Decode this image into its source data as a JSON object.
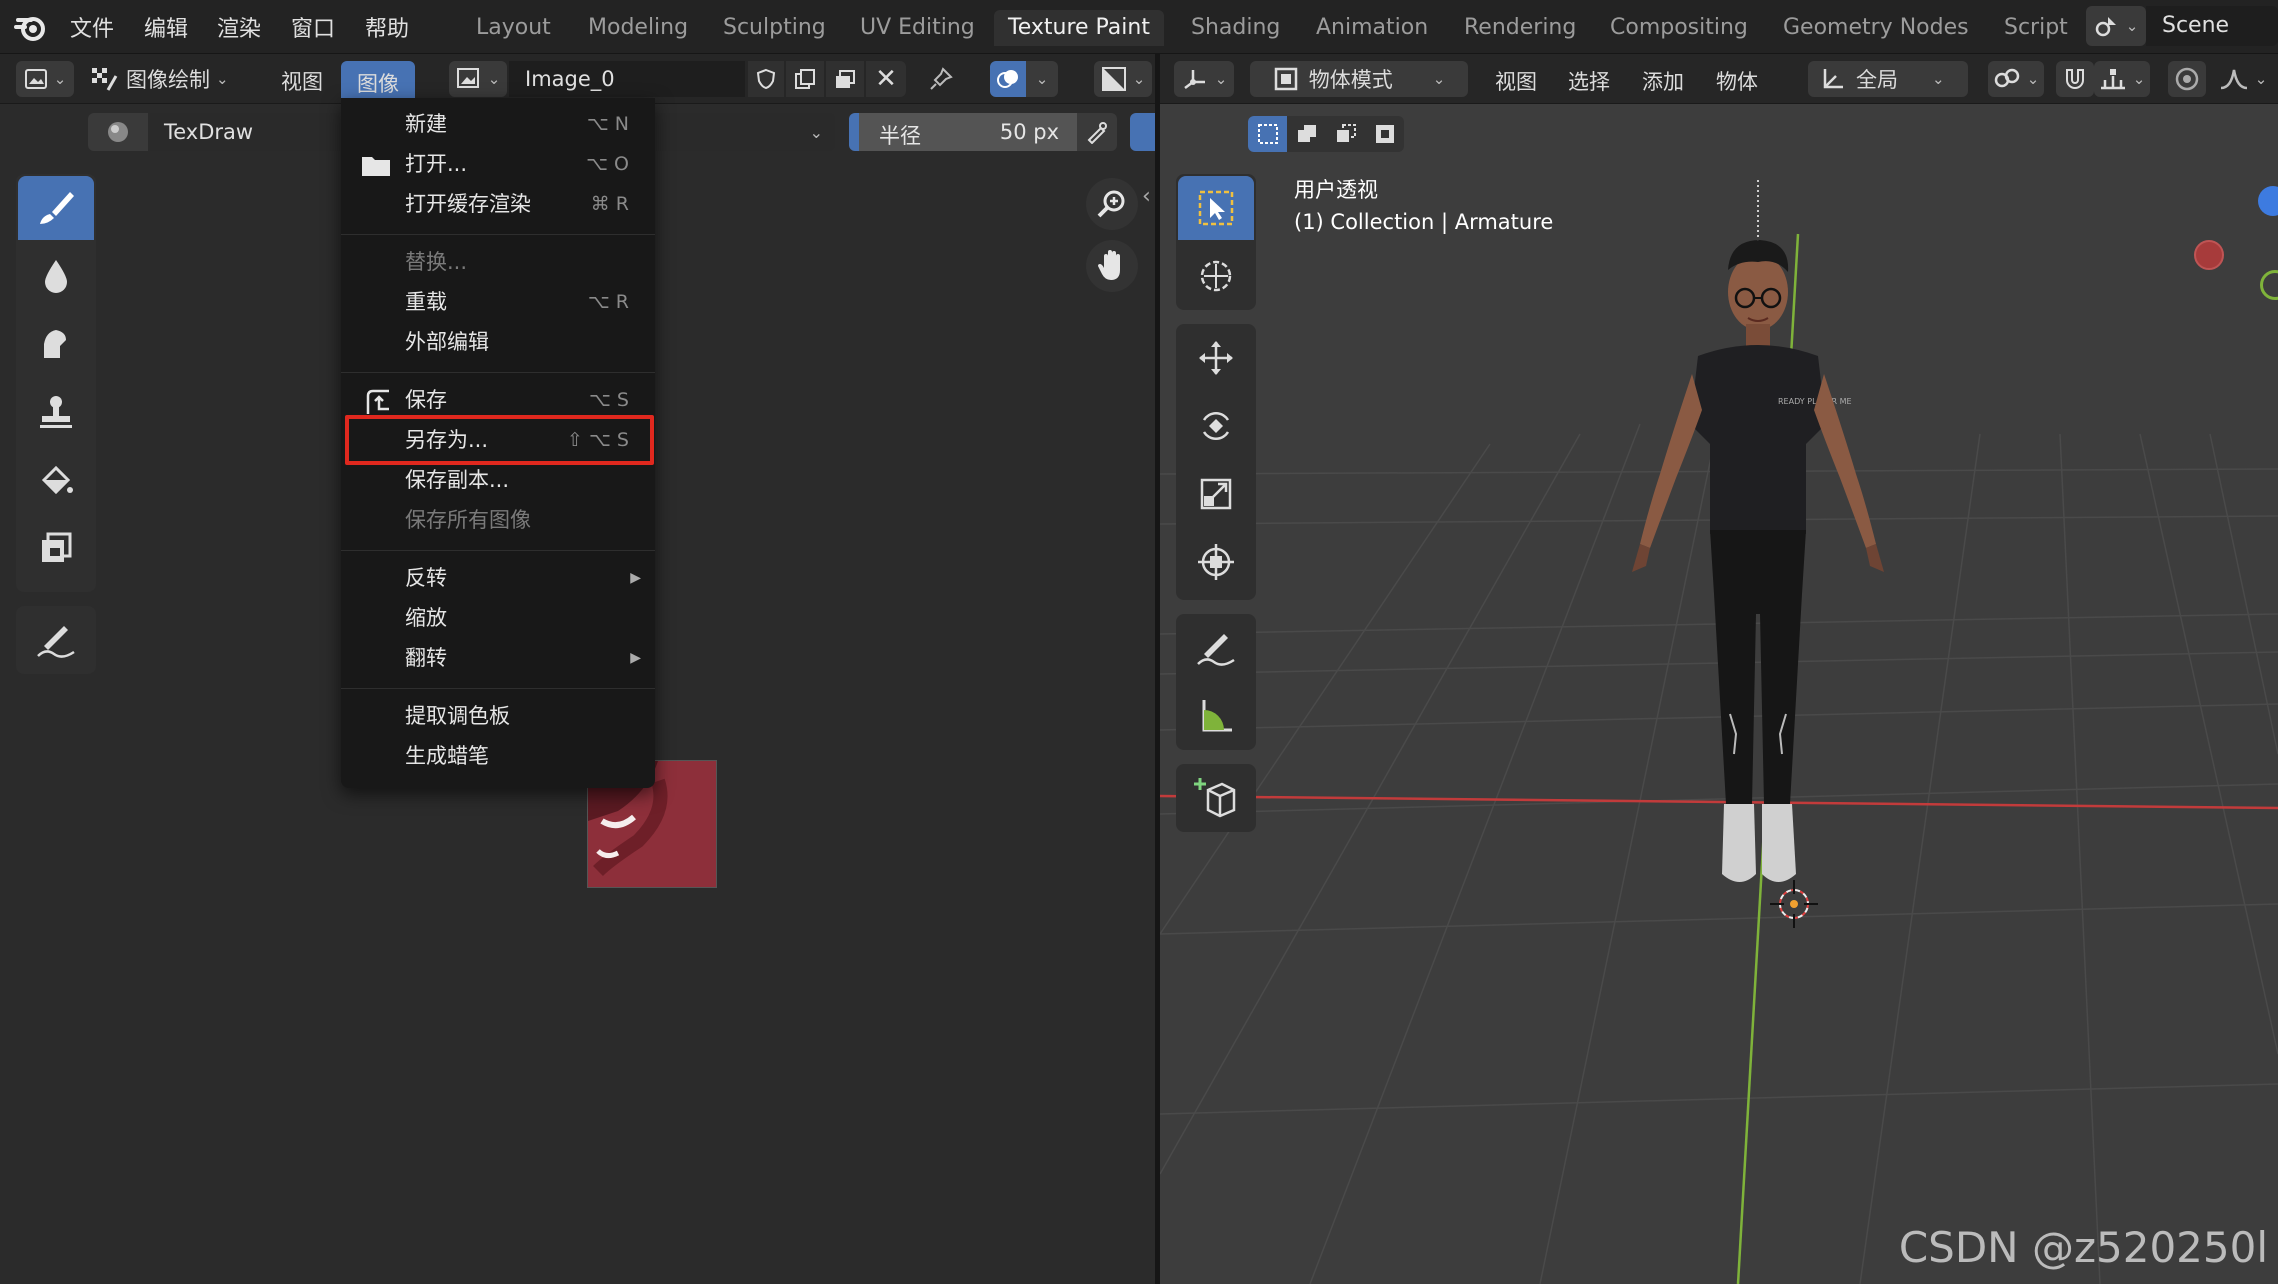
{
  "topbar": {
    "menus": [
      "文件",
      "编辑",
      "渲染",
      "窗口",
      "帮助"
    ],
    "workspaces": [
      "Layout",
      "Modeling",
      "Sculpting",
      "UV Editing",
      "Texture Paint",
      "Shading",
      "Animation",
      "Rendering",
      "Compositing",
      "Geometry Nodes",
      "Script"
    ],
    "active_workspace": "Texture Paint",
    "scene": "Scene"
  },
  "image_editor": {
    "mode": "图像绘制",
    "menu_view": "视图",
    "menu_image": "图像",
    "image_name": "Image_0",
    "brush_name": "TexDraw",
    "radius_label": "半径",
    "radius_value": "50 px"
  },
  "image_menu": {
    "items": [
      {
        "label": "新建",
        "shortcut": "⌥ N",
        "disabled": false
      },
      {
        "label": "打开...",
        "shortcut": "⌥ O",
        "disabled": false
      },
      {
        "label": "打开缓存渲染",
        "shortcut": "⌘ R",
        "disabled": false
      },
      {
        "label": "替换...",
        "shortcut": "",
        "disabled": true
      },
      {
        "label": "重载",
        "shortcut": "⌥ R",
        "disabled": false
      },
      {
        "label": "外部编辑",
        "shortcut": "",
        "disabled": false
      },
      {
        "label": "保存",
        "shortcut": "⌥ S",
        "disabled": false
      },
      {
        "label": "另存为...",
        "shortcut": "⇧ ⌥ S",
        "disabled": false
      },
      {
        "label": "保存副本...",
        "shortcut": "",
        "disabled": false
      },
      {
        "label": "保存所有图像",
        "shortcut": "",
        "disabled": true
      },
      {
        "label": "反转",
        "shortcut": "",
        "disabled": false
      },
      {
        "label": "缩放",
        "shortcut": "",
        "disabled": false
      },
      {
        "label": "翻转",
        "shortcut": "",
        "disabled": false
      },
      {
        "label": "提取调色板",
        "shortcut": "",
        "disabled": false
      },
      {
        "label": "生成蜡笔",
        "shortcut": "",
        "disabled": false
      }
    ],
    "highlighted": "另存为..."
  },
  "viewport": {
    "mode": "物体模式",
    "menus": [
      "视图",
      "选择",
      "添加",
      "物体"
    ],
    "transform_orientation": "全局",
    "view_name": "用户透视",
    "collection_info": "(1) Collection | Armature",
    "shirt_logo": "READY PLAYER ME"
  },
  "watermark": "CSDN @z520250l",
  "colors": {
    "accent": "#4772b3",
    "highlight_box": "#e0281e",
    "x_axis": "#c23b3b",
    "y_axis": "#7fb33a"
  }
}
